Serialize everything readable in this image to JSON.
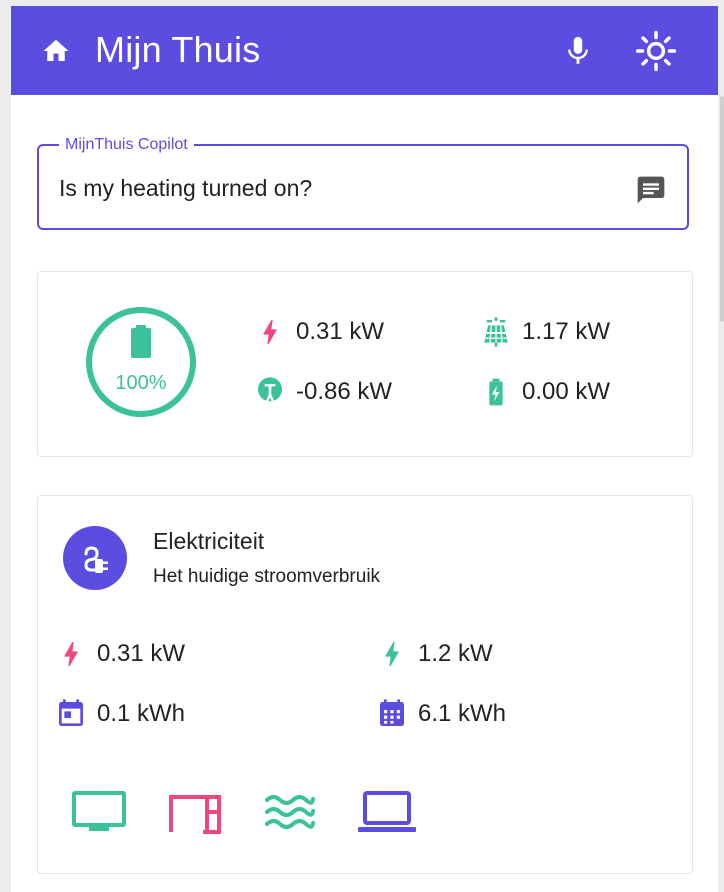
{
  "header": {
    "title": "Mijn Thuis"
  },
  "copilot": {
    "label": "MijnThuis Copilot",
    "value": "Is my heating turned on?"
  },
  "energy": {
    "battery_percent": "100%",
    "battery_level": 1.0,
    "consumption": "0.31 kW",
    "solar": "1.17 kW",
    "grid": "-0.86 kW",
    "battery_power": "0.00 kW"
  },
  "electricity": {
    "title": "Elektriciteit",
    "subtitle": "Het huidige stroomverbruik",
    "current_usage": "0.31 kW",
    "peak_usage": "1.2 kW",
    "today_energy": "0.1 kWh",
    "month_energy": "6.1 kWh"
  },
  "devices": [
    "tv-icon",
    "dishwasher-icon",
    "heating-icon",
    "laptop-icon"
  ],
  "colors": {
    "primary": "#5b4de0",
    "accent_green": "#3cc29a",
    "accent_pink": "#f0487a"
  }
}
